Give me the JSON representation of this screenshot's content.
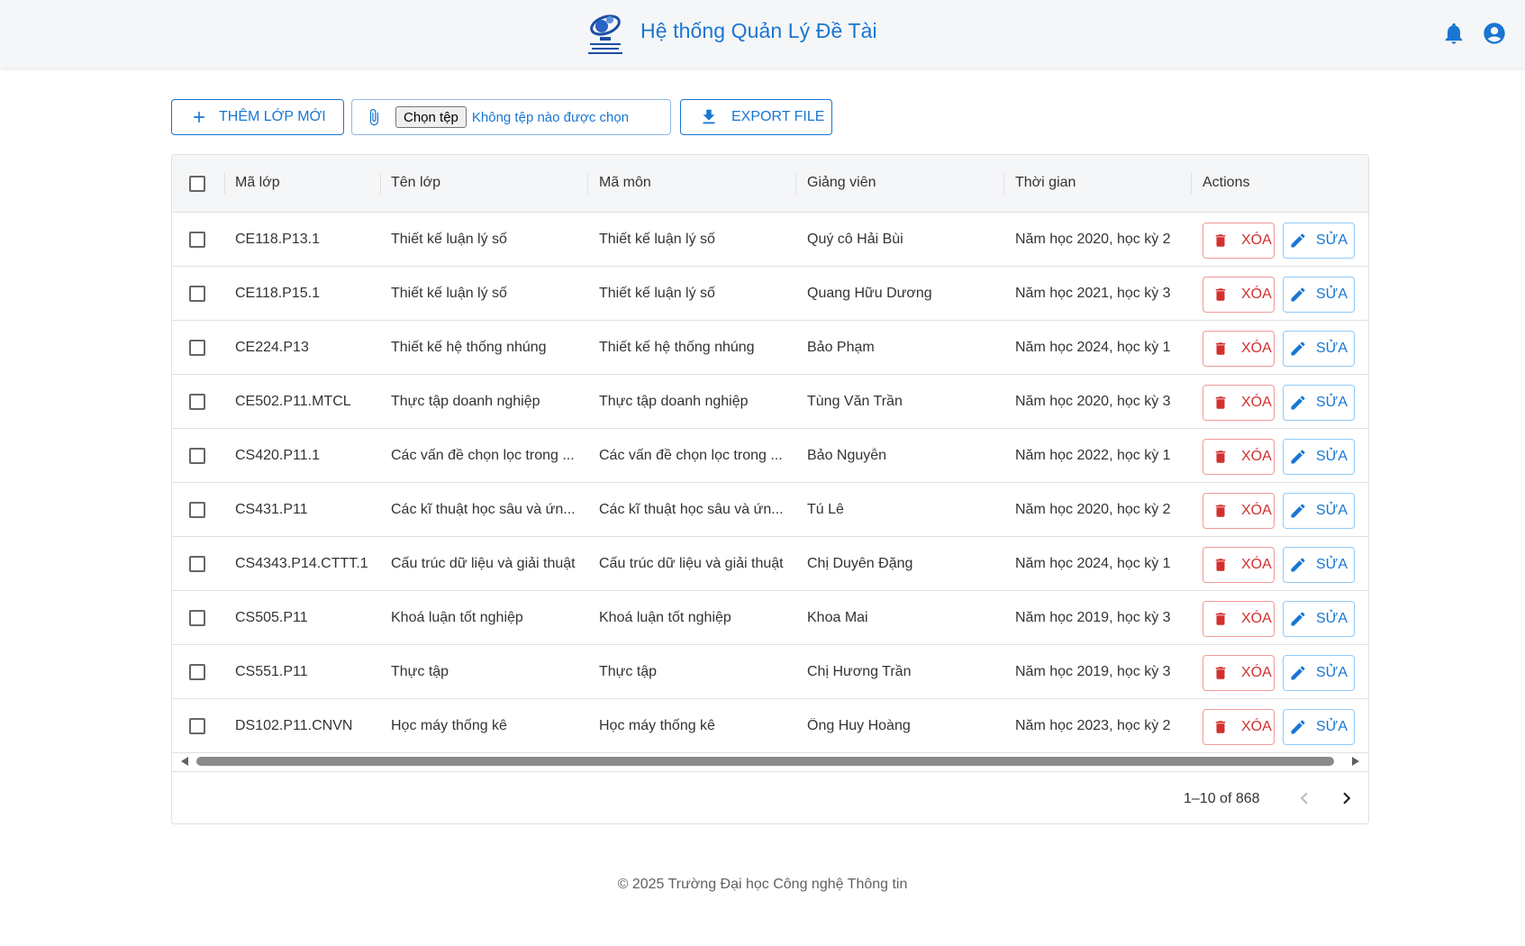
{
  "header": {
    "title": "Hệ thống Quản Lý Đề Tài",
    "logo_icon": "uit-logo",
    "bell_icon": "notification-bell-icon",
    "account_icon": "account-circle-icon",
    "accent": "#1976d2"
  },
  "toolbar": {
    "add_label": "THÊM LỚP MỚI",
    "choose_file_label": "Chọn tệp",
    "no_file_text": "Không tệp nào được chọn",
    "export_label": "EXPORT FILE"
  },
  "table": {
    "columns": [
      "Mã lớp",
      "Tên lớp",
      "Mã môn",
      "Giảng viên",
      "Thời gian",
      "Actions"
    ],
    "delete_label": "XÓA",
    "edit_label": "SỬA",
    "rows": [
      {
        "ma_lop": "CE118.P13.1",
        "ten_lop": "Thiết kế luận lý số",
        "ma_mon": "Thiết kế luận lý số",
        "giang_vien": "Quý cô Hải Bùi",
        "thoi_gian": "Năm học 2020, học kỳ 2"
      },
      {
        "ma_lop": "CE118.P15.1",
        "ten_lop": "Thiết kế luận lý số",
        "ma_mon": "Thiết kế luận lý số",
        "giang_vien": "Quang Hữu Dương",
        "thoi_gian": "Năm học 2021, học kỳ 3"
      },
      {
        "ma_lop": "CE224.P13",
        "ten_lop": "Thiết kế hệ thống nhúng",
        "ma_mon": "Thiết kế hệ thống nhúng",
        "giang_vien": "Bảo Phạm",
        "thoi_gian": "Năm học 2024, học kỳ 1"
      },
      {
        "ma_lop": "CE502.P11.MTCL",
        "ten_lop": "Thực tập doanh nghiệp",
        "ma_mon": "Thực tập doanh nghiệp",
        "giang_vien": "Tùng Văn Trần",
        "thoi_gian": "Năm học 2020, học kỳ 3"
      },
      {
        "ma_lop": "CS420.P11.1",
        "ten_lop": "Các vấn đề chọn lọc trong ...",
        "ma_mon": "Các vấn đề chọn lọc trong ...",
        "giang_vien": "Bảo Nguyễn",
        "thoi_gian": "Năm học 2022, học kỳ 1"
      },
      {
        "ma_lop": "CS431.P11",
        "ten_lop": "Các kĩ thuật học sâu và ứn...",
        "ma_mon": "Các kĩ thuật học sâu và ứn...",
        "giang_vien": "Tú Lê",
        "thoi_gian": "Năm học 2020, học kỳ 2"
      },
      {
        "ma_lop": "CS4343.P14.CTTT.1",
        "ten_lop": "Cấu trúc dữ liệu và giải thuật",
        "ma_mon": "Cấu trúc dữ liệu và giải thuật",
        "giang_vien": "Chị Duyên Đặng",
        "thoi_gian": "Năm học 2024, học kỳ 1"
      },
      {
        "ma_lop": "CS505.P11",
        "ten_lop": "Khoá luận tốt nghiệp",
        "ma_mon": "Khoá luận tốt nghiệp",
        "giang_vien": "Khoa Mai",
        "thoi_gian": "Năm học 2019, học kỳ 3"
      },
      {
        "ma_lop": "CS551.P11",
        "ten_lop": "Thực tập",
        "ma_mon": "Thực tập",
        "giang_vien": "Chị Hương Trần",
        "thoi_gian": "Năm học 2019, học kỳ 3"
      },
      {
        "ma_lop": "DS102.P11.CNVN",
        "ten_lop": "Học máy thống kê",
        "ma_mon": "Học máy thống kê",
        "giang_vien": "Ông Huy Hoàng",
        "thoi_gian": "Năm học 2023, học kỳ 2"
      }
    ],
    "pagination": "1–10 of 868",
    "delete_color": "#d32f2f",
    "edit_color": "#1976d2"
  },
  "footer": {
    "text": "© 2025 Trường Đại học Công nghệ Thông tin"
  }
}
